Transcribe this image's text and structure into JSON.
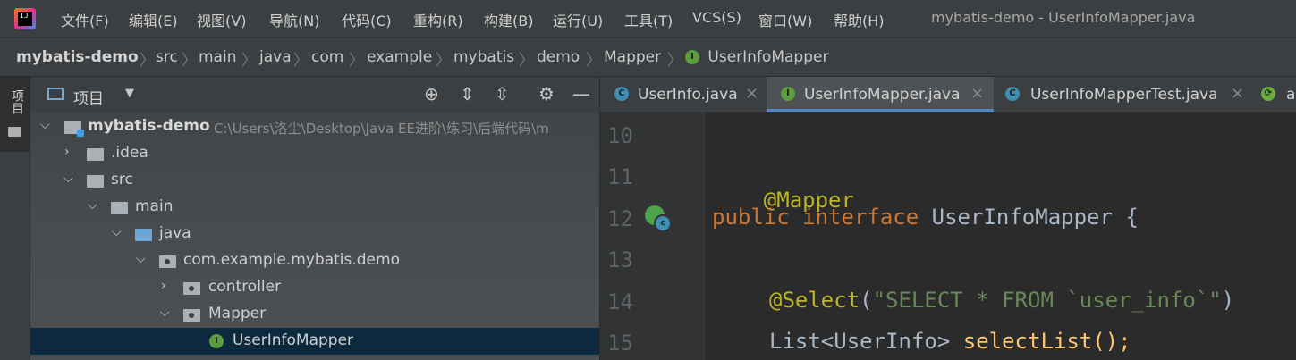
{
  "menubar": {
    "items": [
      "文件(F)",
      "编辑(E)",
      "视图(V)",
      "导航(N)",
      "代码(C)",
      "重构(R)",
      "构建(B)",
      "运行(U)",
      "工具(T)",
      "VCS(S)",
      "窗口(W)",
      "帮助(H)"
    ],
    "window_title": "mybatis-demo - UserInfoMapper.java"
  },
  "breadcrumb": [
    "mybatis-demo",
    "src",
    "main",
    "java",
    "com",
    "example",
    "mybatis",
    "demo",
    "Mapper",
    "UserInfoMapper"
  ],
  "left_strip": {
    "label": "项目"
  },
  "project_panel": {
    "title": "项目",
    "tree": [
      {
        "label": "mybatis-demo",
        "path": "C:\\Users\\洛尘\\Desktop\\Java EE进阶\\练习\\后端代码\\m"
      },
      {
        "label": ".idea"
      },
      {
        "label": "src"
      },
      {
        "label": "main"
      },
      {
        "label": "java"
      },
      {
        "label": "com.example.mybatis.demo"
      },
      {
        "label": "controller"
      },
      {
        "label": "Mapper"
      },
      {
        "label": "UserInfoMapper"
      }
    ]
  },
  "editor_tabs": [
    {
      "label": "UserInfo.java",
      "icon": "class-icon"
    },
    {
      "label": "UserInfoMapper.java",
      "icon": "interface-icon"
    },
    {
      "label": "UserInfoMapperTest.java",
      "icon": "test-class-icon"
    },
    {
      "label": "a",
      "icon": "spring-icon"
    }
  ],
  "editor": {
    "line_numbers": [
      "10",
      "11",
      "12",
      "13",
      "14",
      "15"
    ],
    "lines": {
      "l11_anno": "@Mapper",
      "l12_kw1": "public",
      "l12_kw2": "interface",
      "l12_name": "UserInfoMapper {",
      "l14_anno": "@Select",
      "l14_open": "(",
      "l14_str": "\"SELECT * FROM `user_info`\"",
      "l14_close": ")",
      "l15_type": "List<UserInfo> ",
      "l15_fn": "selectList",
      "l15_end": "();"
    }
  },
  "colors": {
    "accent": "#4a88c7",
    "selection": "#0d293e",
    "annotation": "#bbb529",
    "keyword": "#cc7832",
    "string": "#6a8759",
    "method": "#ffc66d"
  }
}
